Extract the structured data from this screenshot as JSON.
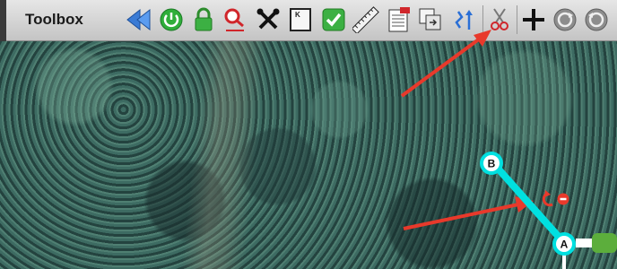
{
  "toolbar": {
    "title": "Toolbox",
    "tools": [
      {
        "icon": "rewind-icon"
      },
      {
        "icon": "power-icon"
      },
      {
        "icon": "lock-icon"
      },
      {
        "icon": "search-icon"
      },
      {
        "icon": "tools-icon"
      },
      {
        "icon": "key-icon",
        "glyph": "K"
      },
      {
        "icon": "checkbox-icon"
      },
      {
        "icon": "ruler-icon"
      },
      {
        "icon": "document-edit-icon"
      },
      {
        "icon": "copy-icon"
      },
      {
        "icon": "split-icon"
      },
      {
        "icon": "scissors-icon"
      },
      {
        "icon": "crosshair-icon"
      },
      {
        "icon": "circle-arrow-icon"
      },
      {
        "icon": "circle-arrow-icon"
      }
    ]
  },
  "map": {
    "segment_color": "#00e0e0",
    "arrow_color": "#e8392b",
    "nodes": [
      {
        "label": "B"
      },
      {
        "label": "A"
      }
    ]
  }
}
